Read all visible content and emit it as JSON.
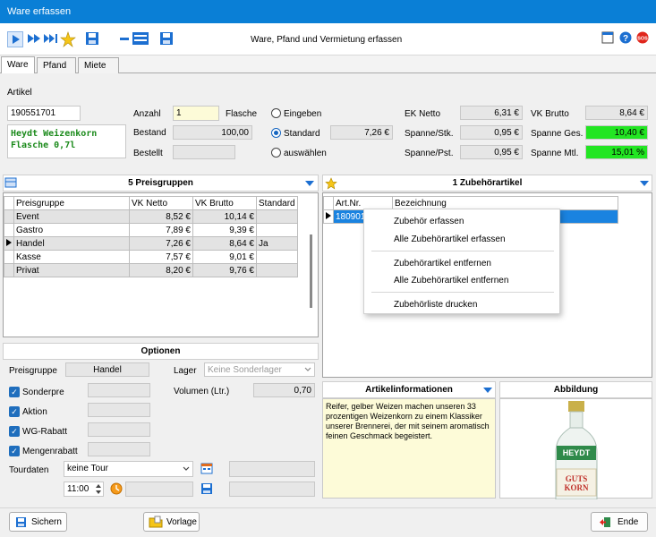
{
  "window": {
    "title": "Ware erfassen"
  },
  "toolbar": {
    "center_title": "Ware, Pfand und Vermietung erfassen"
  },
  "tabs": [
    "Ware",
    "Pfand",
    "Miete"
  ],
  "artikel": {
    "label": "Artikel",
    "number": "190551701",
    "name_line1": "Heydt Weizenkorn",
    "name_line2": "Flasche 0,7l"
  },
  "stock": {
    "anzahl_label": "Anzahl",
    "anzahl_value": "1",
    "anzahl_unit": "Flasche",
    "bestand_label": "Bestand",
    "bestand_value": "100,00",
    "bestellt_label": "Bestellt",
    "bestellt_value": ""
  },
  "price_mode": {
    "eingeben": "Eingeben",
    "standard": "Standard",
    "standard_value": "7,26 €",
    "auswaehlen": "auswählen"
  },
  "prices": {
    "ek_netto_label": "EK Netto",
    "ek_netto": "6,31 €",
    "spanne_stk_label": "Spanne/Stk.",
    "spanne_stk": "0,95 €",
    "spanne_pst_label": "Spanne/Pst.",
    "spanne_pst": "0,95 €",
    "vk_brutto_label": "VK Brutto",
    "vk_brutto": "8,64 €",
    "spanne_ges_label": "Spanne Ges.",
    "spanne_ges": "10,40 €",
    "spanne_mtl_label": "Spanne Mtl.",
    "spanne_mtl": "15,01 %"
  },
  "preisgruppen": {
    "title": "5 Preisgruppen",
    "columns": [
      "Preisgruppe",
      "VK Netto",
      "VK Brutto",
      "Standard"
    ],
    "rows": [
      [
        "Event",
        "8,52 €",
        "10,14 €",
        ""
      ],
      [
        "Gastro",
        "7,89 €",
        "9,39 €",
        ""
      ],
      [
        "Handel",
        "7,26 €",
        "8,64 €",
        "Ja"
      ],
      [
        "Kasse",
        "7,57 €",
        "9,01 €",
        ""
      ],
      [
        "Privat",
        "8,20 €",
        "9,76 €",
        ""
      ]
    ]
  },
  "zubehoer": {
    "title": "1 Zubehörartikel",
    "columns": [
      "Art.Nr.",
      "Bezeichnung"
    ],
    "row_artnr": "180901"
  },
  "context_menu": {
    "items": [
      "Zubehör erfassen",
      "Alle Zubehörartikel erfassen",
      "Zubehörartikel entfernen",
      "Alle Zubehörartikel entfernen",
      "Zubehörliste drucken"
    ]
  },
  "optionen": {
    "title": "Optionen",
    "preisgruppe_label": "Preisgruppe",
    "preisgruppe_value": "Handel",
    "lager_label": "Lager",
    "lager_placeholder": "Keine Sonderlager",
    "volumen_label": "Volumen (Ltr.)",
    "volumen_value": "0,70",
    "checkboxes": [
      "Sonderpre",
      "Aktion",
      "WG-Rabatt",
      "Mengenrabatt"
    ],
    "tourdaten_label": "Tourdaten",
    "tour_value": "keine Tour",
    "time_value": "11:00"
  },
  "artikelinfo": {
    "title": "Artikelinformationen",
    "text": "Reifer, gelber Weizen machen unseren 33 prozentigen Weizenkorn zu einem Klassiker unserer Brennerei, der mit seinem aromatisch feinen Geschmack begeistert."
  },
  "abbildung": {
    "title": "Abbildung",
    "label_top": "HEYDT",
    "label_bottom1": "GUTS",
    "label_bottom2": "KORN"
  },
  "footer": {
    "sichern": "Sichern",
    "vorlage": "Vorlage",
    "ende": "Ende"
  },
  "colors": {
    "titlebar": "#0a7fd6",
    "accent": "#1c6fd1",
    "green_field": "#22e622",
    "selected_row": "#1a83e0"
  }
}
